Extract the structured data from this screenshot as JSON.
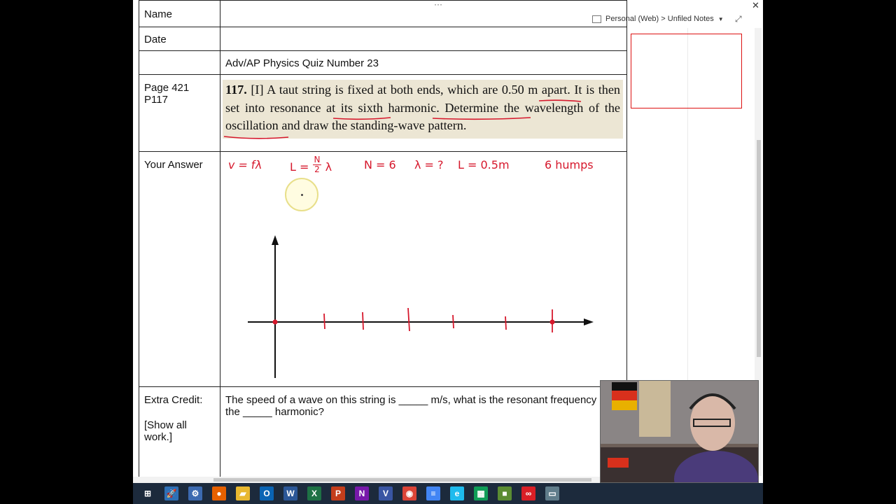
{
  "window": {
    "drag_handle": "···",
    "close_label": "✕"
  },
  "notebook": {
    "path": "Personal (Web) > Unfiled Notes",
    "dropdown": "▼",
    "expand": "⤢"
  },
  "table": {
    "name_label": "Name",
    "date_label": "Date",
    "quiz_title": "Adv/AP Physics Quiz Number 23",
    "page_label": "Page 421",
    "problem_label": "P117",
    "answer_label": "Your Answer",
    "extra_credit_label": "Extra Credit:",
    "show_work_label": "[Show all work.]",
    "extra_credit_line1": "The speed of a wave on this string is _____ m/s, what is the resonant frequency",
    "extra_credit_line2": "the _____ harmonic?"
  },
  "problem": {
    "number": "117.",
    "level": "[I]",
    "text": "A taut string is fixed at both ends, which are 0.50 m apart. It is then set into resonance at its sixth harmonic. Determine the wavelength of the oscillation and draw the standing-wave pattern."
  },
  "handwriting": {
    "eq1": "v = fλ",
    "eq2_left": "L =",
    "eq2_num": "N",
    "eq2_den": "2",
    "eq2_right": "λ",
    "eq3": "N = 6",
    "eq4": "λ = ?",
    "eq5": "L = 0.5m",
    "eq6": "6 humps"
  },
  "taskbar": {
    "items": [
      {
        "name": "start-icon",
        "glyph": "⊞",
        "color": "#1c2a3c"
      },
      {
        "name": "rocket-icon",
        "glyph": "🚀",
        "color": "#2e6fb5"
      },
      {
        "name": "tool-icon",
        "glyph": "⚙",
        "color": "#3c6ab0"
      },
      {
        "name": "firefox-icon",
        "glyph": "●",
        "color": "#e66000"
      },
      {
        "name": "folder-icon",
        "glyph": "▰",
        "color": "#e8b830"
      },
      {
        "name": "outlook-icon",
        "glyph": "O",
        "color": "#0a64b4"
      },
      {
        "name": "word-icon",
        "glyph": "W",
        "color": "#2b5797"
      },
      {
        "name": "excel-icon",
        "glyph": "X",
        "color": "#1e7145"
      },
      {
        "name": "powerpoint-icon",
        "glyph": "P",
        "color": "#c43e1c"
      },
      {
        "name": "onenote-icon",
        "glyph": "N",
        "color": "#7719aa"
      },
      {
        "name": "visio-icon",
        "glyph": "V",
        "color": "#3955a3"
      },
      {
        "name": "chrome-icon",
        "glyph": "◉",
        "color": "#db4437"
      },
      {
        "name": "docs-icon",
        "glyph": "≡",
        "color": "#4285f4"
      },
      {
        "name": "ie-icon",
        "glyph": "e",
        "color": "#1ebbee"
      },
      {
        "name": "sheets-icon",
        "glyph": "▦",
        "color": "#0f9d58"
      },
      {
        "name": "minecraft-icon",
        "glyph": "■",
        "color": "#5b8c32"
      },
      {
        "name": "creative-cloud-icon",
        "glyph": "∞",
        "color": "#da1f26"
      },
      {
        "name": "remote-icon",
        "glyph": "▭",
        "color": "#607d8b"
      }
    ]
  },
  "colors": {
    "ink": "#d6182c",
    "paper_highlight": "#ece6d4",
    "taskbar": "#1c2a3c"
  }
}
